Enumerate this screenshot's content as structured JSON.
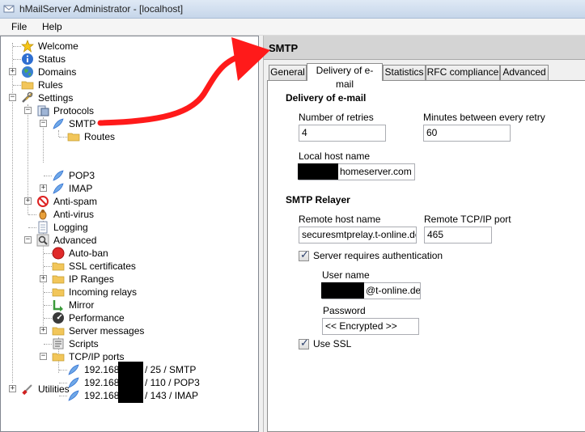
{
  "window": {
    "title": "hMailServer Administrator - [localhost]"
  },
  "menu": {
    "file": "File",
    "help": "Help"
  },
  "tree": {
    "welcome": "Welcome",
    "status": "Status",
    "domains": "Domains",
    "rules": "Rules",
    "settings": "Settings",
    "protocols": "Protocols",
    "smtp": "SMTP",
    "routes": "Routes",
    "pop3": "POP3",
    "imap": "IMAP",
    "antispam": "Anti-spam",
    "antivirus": "Anti-virus",
    "logging": "Logging",
    "advanced": "Advanced",
    "autoban": "Auto-ban",
    "ssl": "SSL certificates",
    "ipranges": "IP Ranges",
    "incoming": "Incoming relays",
    "mirror": "Mirror",
    "performance": "Performance",
    "servermsg": "Server messages",
    "scripts": "Scripts",
    "tcpip": "TCP/IP ports",
    "ports": [
      {
        "prefix": "192.168",
        "suffix": "/ 25 / SMTP"
      },
      {
        "prefix": "192.168",
        "suffix": "/ 110 / POP3"
      },
      {
        "prefix": "192.168",
        "suffix": "/ 143 / IMAP"
      }
    ],
    "utilities": "Utilities"
  },
  "panel": {
    "title": "SMTP",
    "tabs": [
      "General",
      "Delivery of e-mail",
      "Statistics",
      "RFC compliance",
      "Advanced"
    ],
    "active_tab": 1,
    "delivery": {
      "heading": "Delivery of e-mail",
      "retries_label": "Number of retries",
      "retries_value": "4",
      "minutes_label": "Minutes between every retry",
      "minutes_value": "60",
      "hostname_label": "Local host name",
      "hostname_value": "homeserver.com"
    },
    "relayer": {
      "heading": "SMTP Relayer",
      "remote_host_label": "Remote host name",
      "remote_host_value": "securesmtprelay.t-online.de",
      "remote_port_label": "Remote TCP/IP port",
      "remote_port_value": "465",
      "auth_label": "Server requires authentication",
      "auth_checked": true,
      "username_label": "User name",
      "username_value": "@t-online.de",
      "password_label": "Password",
      "password_value": "<< Encrypted >>",
      "ssl_label": "Use SSL",
      "ssl_checked": true
    }
  },
  "colors": {
    "annotation_arrow": "#ff0000",
    "globe_icon": "#3a7fd0",
    "folder_icon": "#f2c65a"
  }
}
